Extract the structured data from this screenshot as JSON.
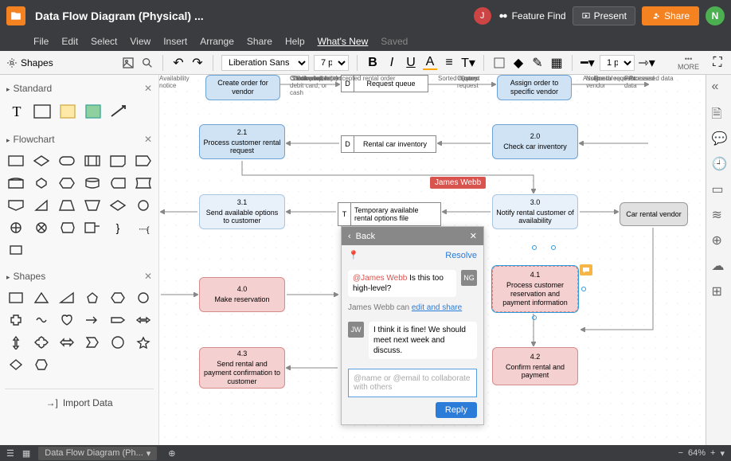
{
  "header": {
    "doc_title": "Data Flow Diagram (Physical) ...",
    "menu": [
      "File",
      "Edit",
      "Select",
      "View",
      "Insert",
      "Arrange",
      "Share",
      "Help",
      "What's New"
    ],
    "saved": "Saved",
    "user_j": "J",
    "feature_find": "Feature Find",
    "present": "Present",
    "share": "Share",
    "user_n": "N"
  },
  "toolbar": {
    "shapes": "Shapes",
    "font": "Liberation Sans",
    "size": "7 pt",
    "line_width": "1 px",
    "more": "MORE"
  },
  "panels": {
    "standard": "Standard",
    "flowchart": "Flowchart",
    "shapes": "Shapes",
    "import_data": "Import Data"
  },
  "canvas": {
    "n_create": {
      "title": "Create order for vendor"
    },
    "n_assign": {
      "title": "Assign order to specific vendor"
    },
    "n_21": {
      "num": "2.1",
      "title": "Process customer rental request"
    },
    "n_20": {
      "num": "2.0",
      "title": "Check car inventory"
    },
    "n_31": {
      "num": "3.1",
      "title": "Send available options to customer"
    },
    "n_30": {
      "num": "3.0",
      "title": "Notify rental customer of availability"
    },
    "n_40": {
      "num": "4.0",
      "title": "Make reservation"
    },
    "n_41": {
      "num": "4.1",
      "title": "Process customer reservation and payment information"
    },
    "n_42": {
      "num": "4.2",
      "title": "Confirm rental and payment"
    },
    "n_43": {
      "num": "4.3",
      "title": "Send rental and payment confirmation to customer"
    },
    "n_vendor": {
      "title": "Car rental vendor"
    },
    "ds_queue": {
      "d": "D",
      "title": "Request queue"
    },
    "ds_inventory": {
      "d": "D",
      "title": "Rental car inventory"
    },
    "ds_temp": {
      "d": "T",
      "title": "Temporary available rental options file"
    },
    "labels": {
      "order_request": "Order request",
      "sorted_request": "Sorted request",
      "assigned_request": "Assigned request",
      "stock_avail": "Stock availability",
      "query": "Query",
      "rental_request": "Rental request",
      "accepted": "Accepted rental order",
      "avail_notice": "Availability notice",
      "compiled": "Compiled report",
      "custom_req": "Custom request",
      "notice_to": "Notice to vendor",
      "processed": "Processed data",
      "credit": "Credit card, debit card, or cash",
      "checked": "Checked order",
      "processed_data": "Processed data"
    },
    "cursor_tag": "James Webb"
  },
  "comments": {
    "back": "Back",
    "resolve": "Resolve",
    "ng": "NG",
    "jw": "JW",
    "mention": "@James Webb",
    "msg1": "Is this too high-level?",
    "note_pre": "James Webb can ",
    "note_link": "edit and share",
    "msg2": "I think it is fine! We should meet next week and discuss.",
    "placeholder": "@name or @email to collaborate with others",
    "reply": "Reply"
  },
  "statusbar": {
    "tab": "Data Flow Diagram (Ph...",
    "zoom": "64%"
  }
}
